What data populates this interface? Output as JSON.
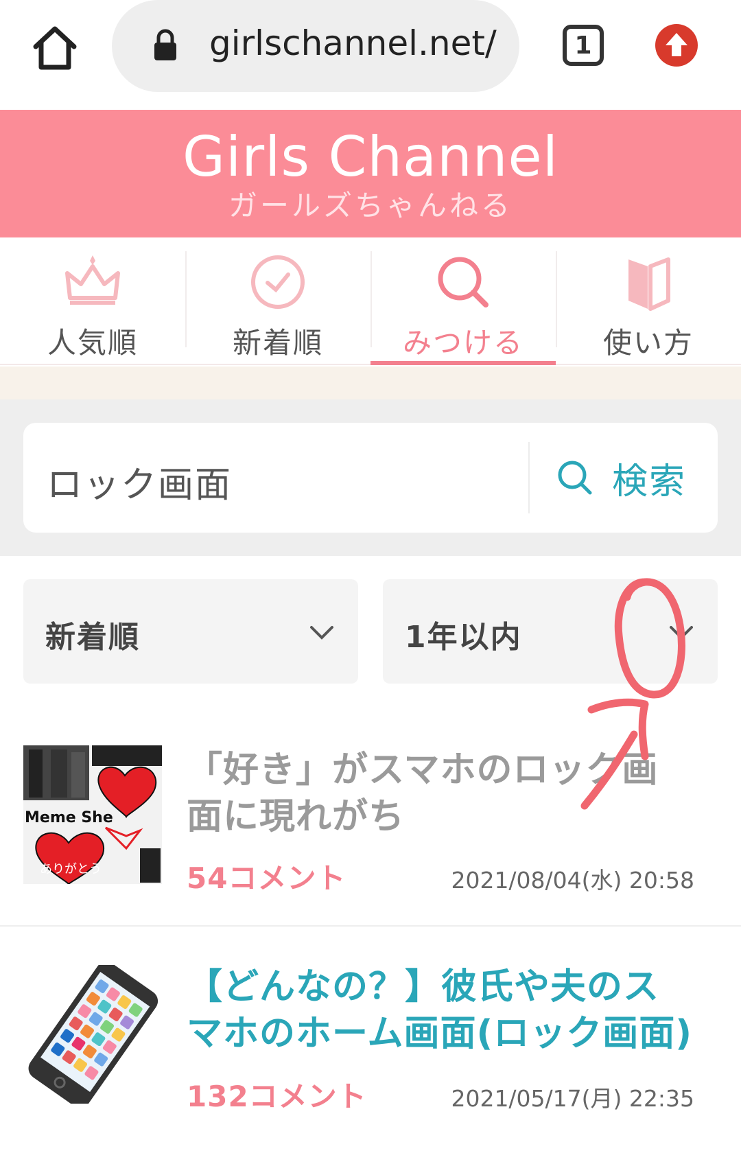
{
  "browser": {
    "url": "girlschannel.net/t",
    "tab_count": "1"
  },
  "header": {
    "logo": "Girls Channel",
    "logo_sub": "ガールズちゃんねる"
  },
  "nav": {
    "tabs": [
      {
        "label": "人気順",
        "icon": "crown-icon"
      },
      {
        "label": "新着順",
        "icon": "clock-icon"
      },
      {
        "label": "みつける",
        "icon": "search-icon",
        "active": true
      },
      {
        "label": "使い方",
        "icon": "book-icon"
      }
    ]
  },
  "search": {
    "value": "ロック画面",
    "button_label": "検索"
  },
  "filters": {
    "sort": "新着順",
    "period": "1年以内"
  },
  "topics": [
    {
      "title": "「好き」がスマホのロック画面に現れがち",
      "comments": "54コメント",
      "date": "2021/08/04(水) 20:58",
      "thumb_text": "Meme She",
      "thumb_text2": "ありがとう"
    },
    {
      "title": "【どんなの？】彼氏や夫のスマホのホーム画面(ロック画面)",
      "comments": "132コメント",
      "date": "2021/05/17(月) 22:35"
    }
  ],
  "colors": {
    "brand_pink": "#fb8c97",
    "accent_pink": "#f3808e",
    "teal": "#2aa6b8",
    "annotation_red": "#f0666f"
  }
}
